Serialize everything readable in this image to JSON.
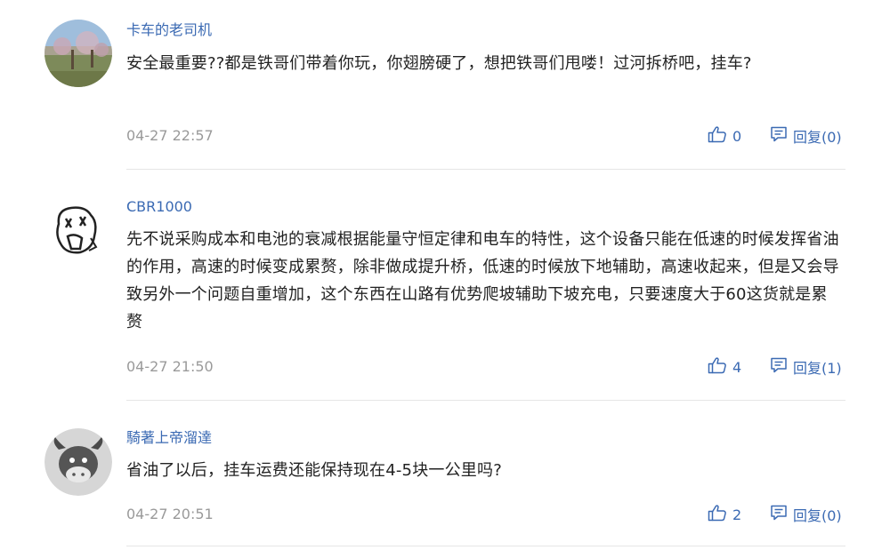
{
  "comments": [
    {
      "username": "卡车的老司机",
      "avatar": "landscape-photo-avatar",
      "content": "安全最重要??都是铁哥们带着你玩，你翅膀硬了，想把铁哥们甩喽！过河拆桥吧，挂车?",
      "time": "04-27 22:57",
      "likes": "0",
      "reply": "回复(0)"
    },
    {
      "username": "CBR1000",
      "avatar": "cartoon-sketch-avatar",
      "content": "先不说采购成本和电池的衰减根据能量守恒定律和电车的特性，这个设备只能在低速的时候发挥省油的作用，高速的时候变成累赘，除非做成提升桥，低速的时候放下地辅助，高速收起来，但是又会导致另外一个问题自重增加，这个东西在山路有优势爬坡辅助下坡充电，只要速度大于60这货就是累赘",
      "time": "04-27 21:50",
      "likes": "4",
      "reply": "回复(1)"
    },
    {
      "username": "騎著上帝溜達",
      "avatar": "cartoon-bull-avatar",
      "content": "省油了以后，挂车运费还能保持现在4-5块一公里吗?",
      "time": "04-27 20:51",
      "likes": "2",
      "reply": "回复(0)"
    }
  ],
  "icons": {
    "like": "thumbs-up-icon",
    "reply": "comment-icon"
  },
  "colors": {
    "accent": "#3b6ab3",
    "text": "#222222",
    "muted": "#9a9a9a",
    "divider": "#e6e6e6"
  }
}
